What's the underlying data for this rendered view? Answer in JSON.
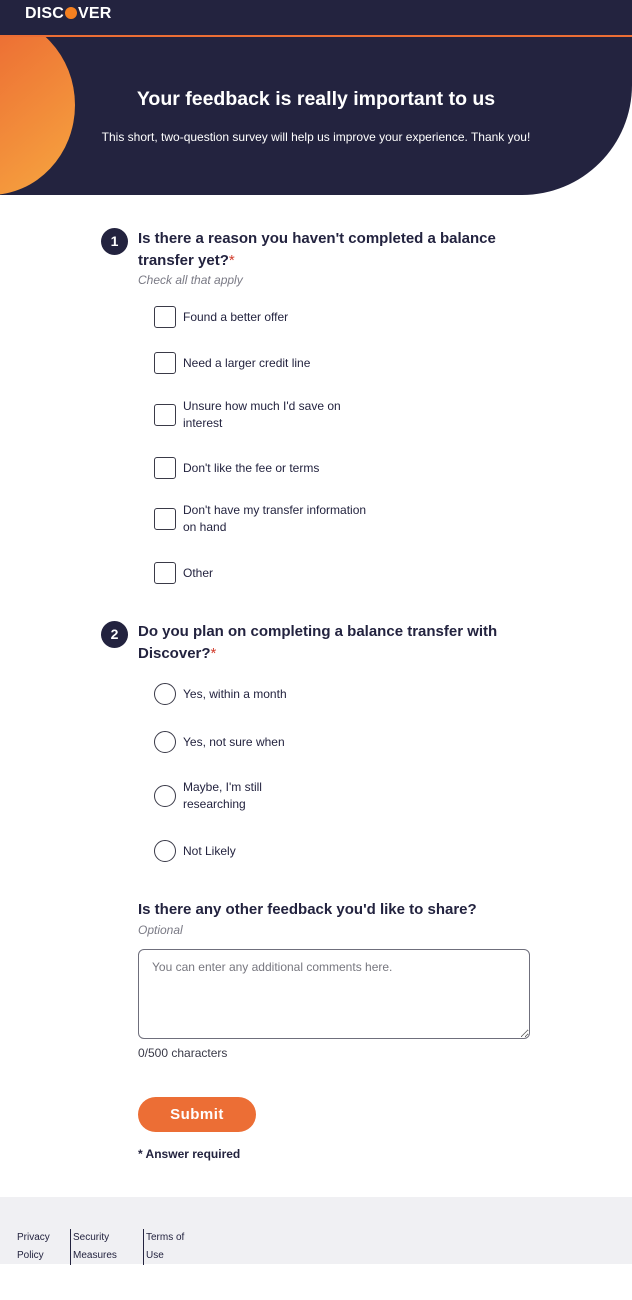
{
  "brand": {
    "logo_left": "DISC",
    "logo_right": "VER",
    "accent_color": "#ec6e35",
    "navy_color": "#23233f"
  },
  "hero": {
    "title": "Your feedback is really important to us",
    "subtitle": "This short, two-question survey will help us improve your experience. Thank you!"
  },
  "q1": {
    "number": "1",
    "text": "Is there a reason you haven't completed a balance transfer yet?",
    "required_mark": "*",
    "hint": "Check all that apply",
    "options": [
      "Found a better offer",
      "Need a larger credit line",
      "Unsure how much I'd save on interest",
      "Don't like the fee or terms",
      "Don't have my transfer information on hand",
      "Other"
    ]
  },
  "q2": {
    "number": "2",
    "text": "Do you plan on completing a balance transfer with Discover?",
    "required_mark": "*",
    "options": [
      "Yes, within a month",
      "Yes, not sure when",
      "Maybe, I'm still researching",
      "Not Likely"
    ]
  },
  "feedback": {
    "title": "Is there any other feedback you'd like to share?",
    "hint": "Optional",
    "placeholder": "You can enter any additional comments here.",
    "counter": "0/500 characters"
  },
  "submit_label": "Submit",
  "required_note": "* Answer required",
  "footer": {
    "links": [
      "Privacy Policy",
      "Security Measures",
      "Terms of Use"
    ]
  }
}
